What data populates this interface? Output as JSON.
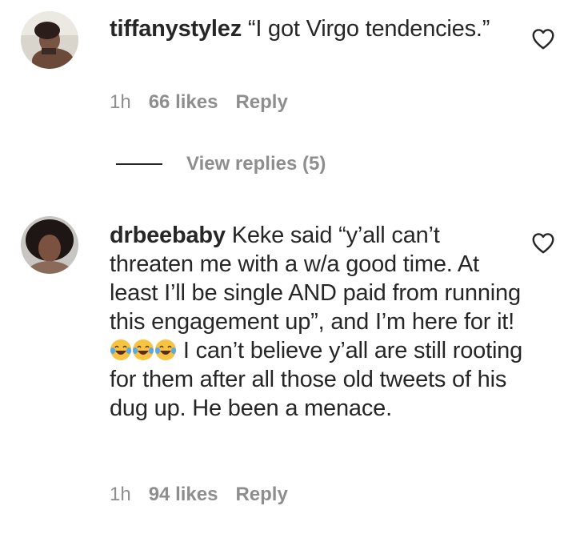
{
  "comments": [
    {
      "username": "tiffanystylez",
      "text": "“I got Virgo tendencies.”",
      "time": "1h",
      "likes": "66 likes",
      "reply": "Reply"
    },
    {
      "username": "drbeebaby",
      "text_before": "Keke said “y’all can’t threaten me with a w/a good time. At least I’ll be single AND paid from running this engagement up”, and I’m here for it!",
      "emoji": [
        "laugh-cry-emoji",
        "laugh-cry-emoji",
        "laugh-cry-emoji"
      ],
      "text_after": "I can’t believe y’all are still rooting for them after all those old tweets of his dug up. He been a menace.",
      "time": "1h",
      "likes": "94 likes",
      "reply": "Reply"
    }
  ],
  "view_replies": "View replies (5)",
  "colors": {
    "text": "#262626",
    "meta": "#8e8e8e",
    "emoji_face": "#f7c341"
  }
}
